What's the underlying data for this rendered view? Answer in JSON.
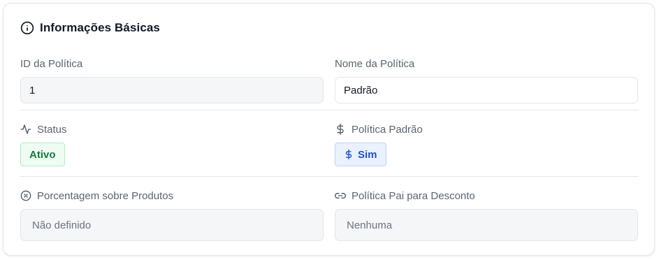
{
  "section": {
    "title": "Informações Básicas",
    "icon": "info-circle-icon"
  },
  "fields": {
    "policy_id": {
      "label": "ID da Política",
      "value": "1"
    },
    "policy_name": {
      "label": "Nome da Política",
      "value": "Padrão"
    },
    "status": {
      "label": "Status",
      "icon": "activity-icon",
      "badge": "Ativo",
      "badge_color": "#157a3b"
    },
    "default_policy": {
      "label": "Política Padrão",
      "icon": "dollar-icon",
      "badge": "Sim",
      "badge_color": "#1e4fd6"
    },
    "product_percentage": {
      "label": "Porcentagem sobre Produtos",
      "icon": "percent-badge-icon",
      "placeholder": "Não definido"
    },
    "parent_discount_policy": {
      "label": "Política Pai para Desconto",
      "icon": "link-icon",
      "placeholder": "Nenhuma"
    }
  }
}
